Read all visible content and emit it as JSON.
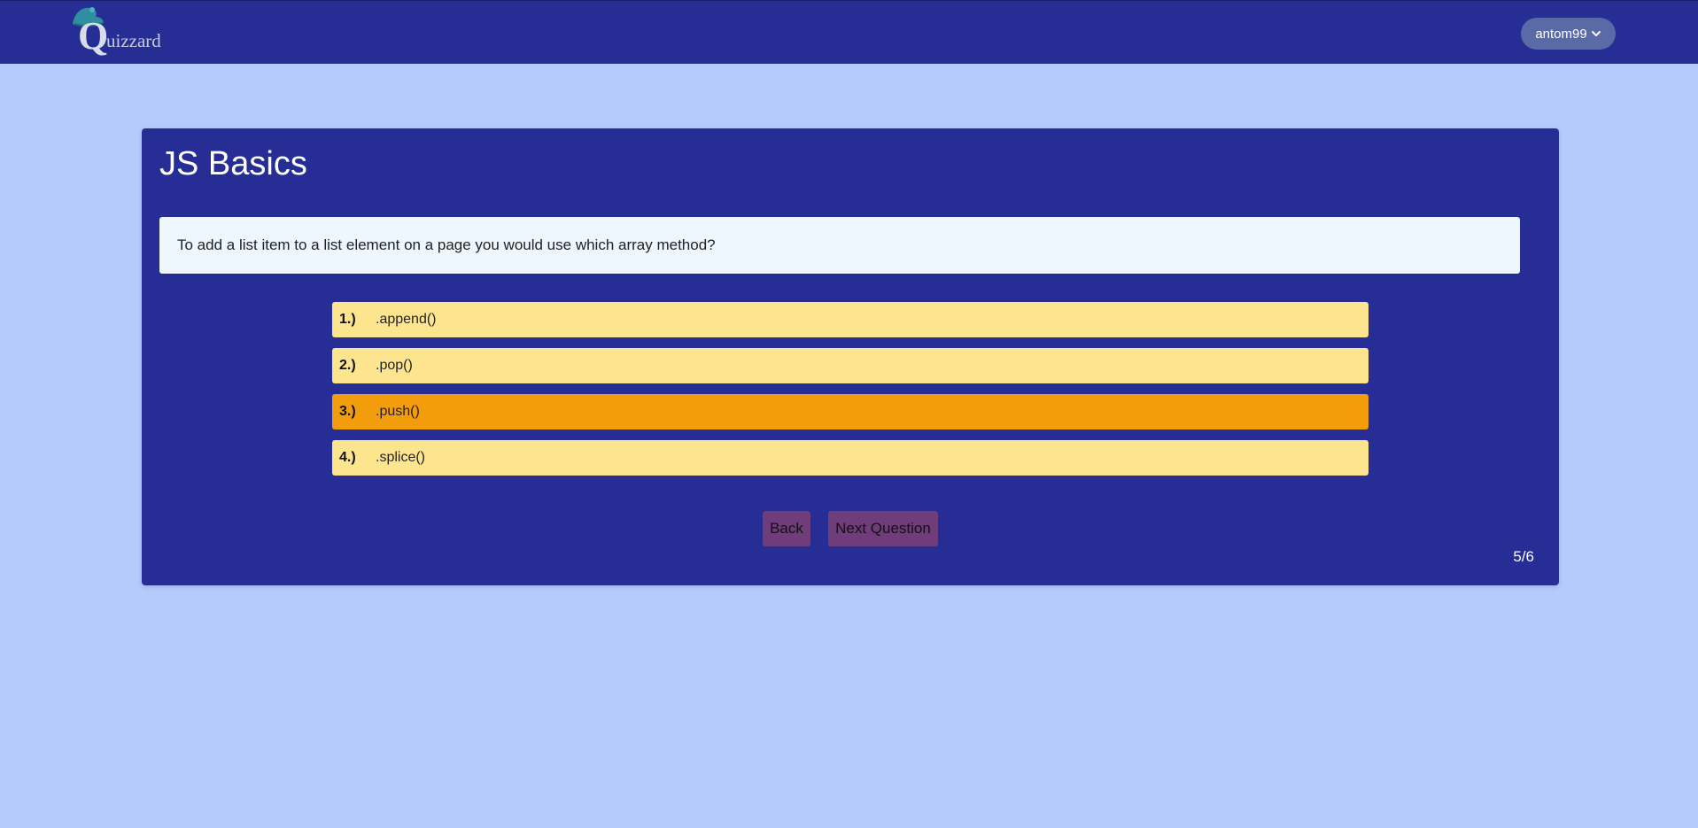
{
  "header": {
    "logo": {
      "initial": "Q",
      "rest": "uizzard",
      "icon": "wizard-hat-icon"
    },
    "user_menu": {
      "label": "antom99",
      "icon": "chevron-down-icon"
    }
  },
  "quiz": {
    "title": "JS Basics",
    "question": "To add a list item to a list element on a page you would use which array method?",
    "answers": [
      {
        "number": "1.)",
        "text": ".append()",
        "selected": false
      },
      {
        "number": "2.)",
        "text": ".pop()",
        "selected": false
      },
      {
        "number": "3.)",
        "text": ".push()",
        "selected": true
      },
      {
        "number": "4.)",
        "text": ".splice()",
        "selected": false
      }
    ],
    "back_label": "Back",
    "next_label": "Next Question",
    "progress": "5/6"
  },
  "colors": {
    "page_background": "#b5cbfc",
    "navbar": "#262e95",
    "card": "#262e95",
    "answer": "#fde58f",
    "answer_selected": "#f49d0c",
    "button": "#6e3d7a",
    "user_button": "#5a6aa6"
  }
}
